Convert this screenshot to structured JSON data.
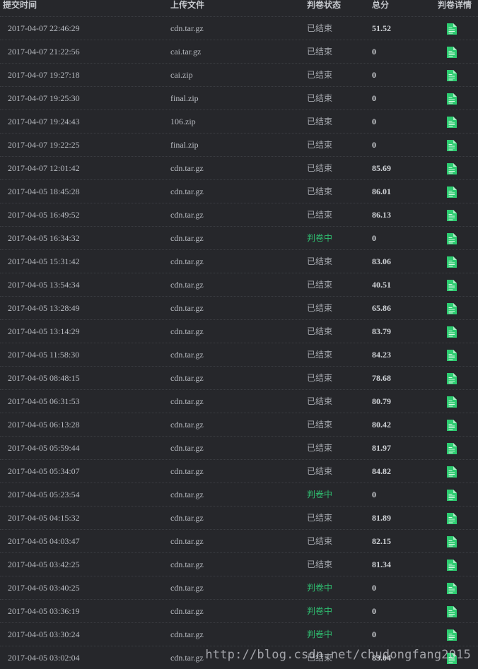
{
  "headers": {
    "time": "提交时间",
    "file": "上传文件",
    "status": "判卷状态",
    "score": "总分",
    "detail": "判卷详情"
  },
  "status_labels": {
    "done": "已结束",
    "judging": "判卷中"
  },
  "colors": {
    "background": "#26272b",
    "judging": "#2fbf71",
    "detail_icon": "#2ecc71"
  },
  "detail_icon": "document-icon",
  "rows": [
    {
      "time": "2017-04-07 22:46:29",
      "file": "cdn.tar.gz",
      "status": "已结束",
      "score": "51.52"
    },
    {
      "time": "2017-04-07 21:22:56",
      "file": "cai.tar.gz",
      "status": "已结束",
      "score": "0"
    },
    {
      "time": "2017-04-07 19:27:18",
      "file": "cai.zip",
      "status": "已结束",
      "score": "0"
    },
    {
      "time": "2017-04-07 19:25:30",
      "file": "final.zip",
      "status": "已结束",
      "score": "0"
    },
    {
      "time": "2017-04-07 19:24:43",
      "file": "106.zip",
      "status": "已结束",
      "score": "0"
    },
    {
      "time": "2017-04-07 19:22:25",
      "file": "final.zip",
      "status": "已结束",
      "score": "0"
    },
    {
      "time": "2017-04-07 12:01:42",
      "file": "cdn.tar.gz",
      "status": "已结束",
      "score": "85.69"
    },
    {
      "time": "2017-04-05 18:45:28",
      "file": "cdn.tar.gz",
      "status": "已结束",
      "score": "86.01"
    },
    {
      "time": "2017-04-05 16:49:52",
      "file": "cdn.tar.gz",
      "status": "已结束",
      "score": "86.13"
    },
    {
      "time": "2017-04-05 16:34:32",
      "file": "cdn.tar.gz",
      "status": "判卷中",
      "score": "0"
    },
    {
      "time": "2017-04-05 15:31:42",
      "file": "cdn.tar.gz",
      "status": "已结束",
      "score": "83.06"
    },
    {
      "time": "2017-04-05 13:54:34",
      "file": "cdn.tar.gz",
      "status": "已结束",
      "score": "40.51"
    },
    {
      "time": "2017-04-05 13:28:49",
      "file": "cdn.tar.gz",
      "status": "已结束",
      "score": "65.86"
    },
    {
      "time": "2017-04-05 13:14:29",
      "file": "cdn.tar.gz",
      "status": "已结束",
      "score": "83.79"
    },
    {
      "time": "2017-04-05 11:58:30",
      "file": "cdn.tar.gz",
      "status": "已结束",
      "score": "84.23"
    },
    {
      "time": "2017-04-05 08:48:15",
      "file": "cdn.tar.gz",
      "status": "已结束",
      "score": "78.68"
    },
    {
      "time": "2017-04-05 06:31:53",
      "file": "cdn.tar.gz",
      "status": "已结束",
      "score": "80.79"
    },
    {
      "time": "2017-04-05 06:13:28",
      "file": "cdn.tar.gz",
      "status": "已结束",
      "score": "80.42"
    },
    {
      "time": "2017-04-05 05:59:44",
      "file": "cdn.tar.gz",
      "status": "已结束",
      "score": "81.97"
    },
    {
      "time": "2017-04-05 05:34:07",
      "file": "cdn.tar.gz",
      "status": "已结束",
      "score": "84.82"
    },
    {
      "time": "2017-04-05 05:23:54",
      "file": "cdn.tar.gz",
      "status": "判卷中",
      "score": "0"
    },
    {
      "time": "2017-04-05 04:15:32",
      "file": "cdn.tar.gz",
      "status": "已结束",
      "score": "81.89"
    },
    {
      "time": "2017-04-05 04:03:47",
      "file": "cdn.tar.gz",
      "status": "已结束",
      "score": "82.15"
    },
    {
      "time": "2017-04-05 03:42:25",
      "file": "cdn.tar.gz",
      "status": "已结束",
      "score": "81.34"
    },
    {
      "time": "2017-04-05 03:40:25",
      "file": "cdn.tar.gz",
      "status": "判卷中",
      "score": "0"
    },
    {
      "time": "2017-04-05 03:36:19",
      "file": "cdn.tar.gz",
      "status": "判卷中",
      "score": "0"
    },
    {
      "time": "2017-04-05 03:30:24",
      "file": "cdn.tar.gz",
      "status": "判卷中",
      "score": "0"
    },
    {
      "time": "2017-04-05 03:02:04",
      "file": "cdn.tar.gz",
      "status": "已结束",
      "score": "83.04"
    }
  ],
  "watermark": "http://blog.csdn.net/chudongfang2015"
}
